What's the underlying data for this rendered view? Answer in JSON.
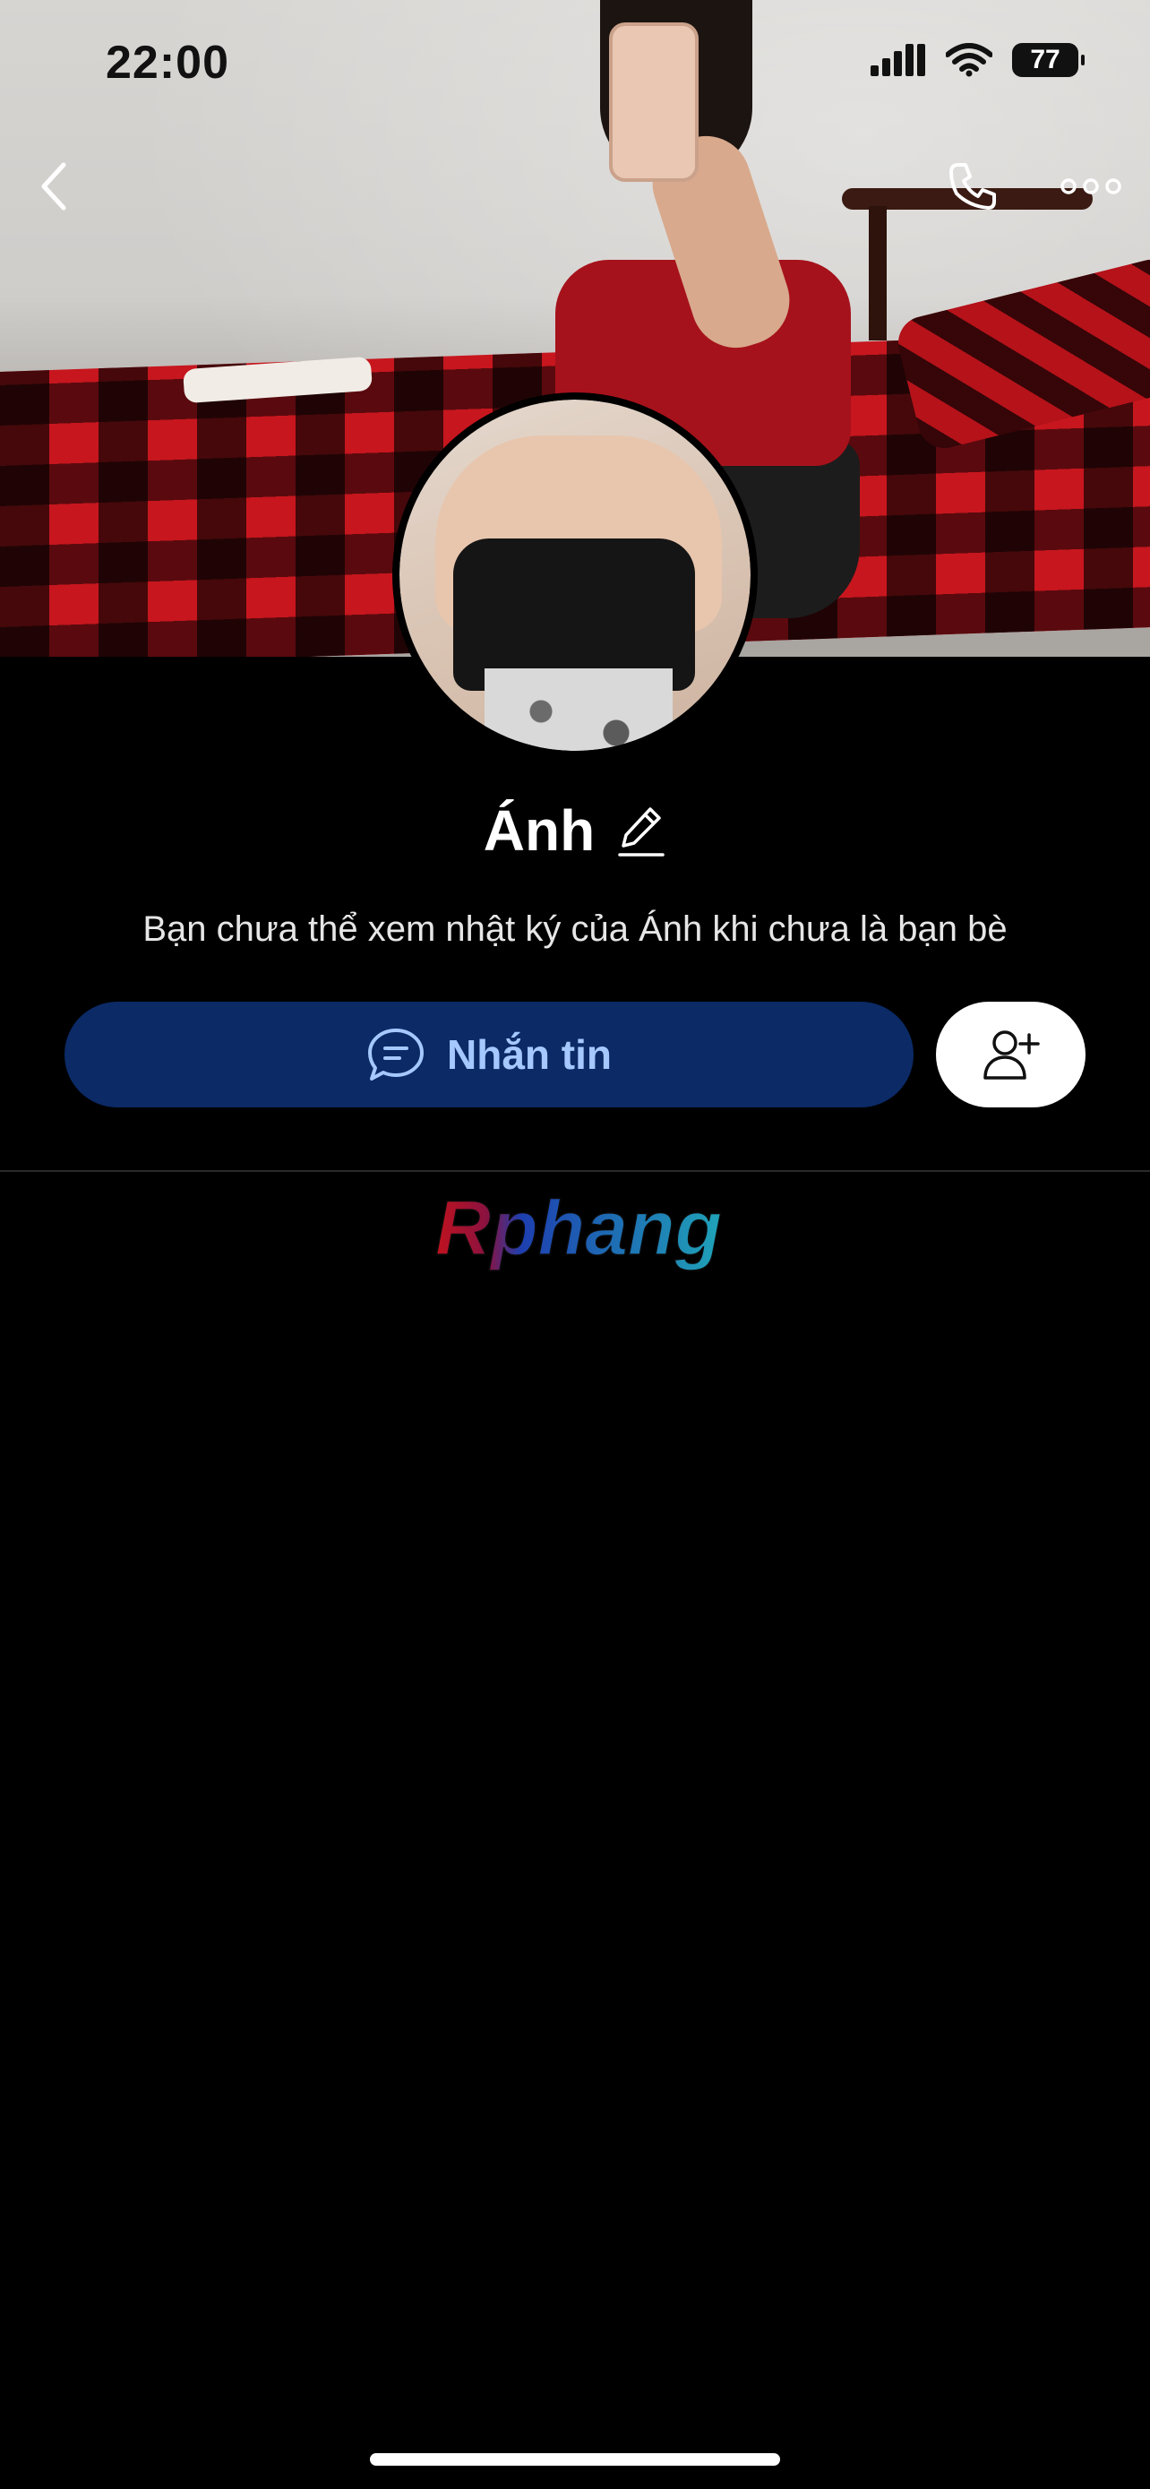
{
  "status_bar": {
    "time": "22:00",
    "battery": "77",
    "text_color": "#111111"
  },
  "nav": {
    "back_icon": "chevron-left-icon",
    "call_icon": "phone-icon",
    "more_icon": "more-dots-icon"
  },
  "profile": {
    "name": "Ánh",
    "privacy_notice": "Bạn chưa thể xem nhật ký của Ánh khi chưa là bạn bè"
  },
  "actions": {
    "message_label": "Nhắn tin",
    "message_icon": "chat-bubble-icon",
    "add_friend_icon": "add-user-icon"
  },
  "watermark": {
    "text": "Rphang"
  },
  "colors": {
    "background": "#000000",
    "message_button_bg": "#0b2a66",
    "message_button_text": "#a5c8ff",
    "add_friend_bg": "#ffffff"
  }
}
